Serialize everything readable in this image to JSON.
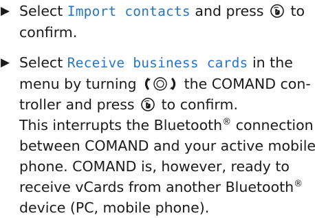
{
  "bullet_symbol": "▶",
  "step1": {
    "before": "Select ",
    "term": "Import contacts",
    "after": " and press",
    "end": " to",
    "line2": "confirm.",
    "icon": "press-confirm-icon"
  },
  "step2": {
    "before": "Select ",
    "term": "Receive business cards",
    "after": " in the",
    "line2_before": "menu by turning ",
    "line2_after": " the COMAND con-",
    "line3_before": "troller and press ",
    "line3_after": " to confirm.",
    "icons": [
      "turn-controller-icon",
      "press-confirm-icon"
    ]
  },
  "note": {
    "line1_before": "This interrupts the Bluetooth",
    "line1_reg": "®",
    "line1_after": " connection",
    "line2": "between COMAND and your active mobile",
    "line3": "phone. COMAND is, however, ready to",
    "line4_before": "receive vCards from another Bluetooth",
    "line4_reg": "®",
    "line5": "device (PC, mobile phone)."
  },
  "colors": {
    "text": "#1a1a1a",
    "menu_term": "#2a74c6"
  }
}
